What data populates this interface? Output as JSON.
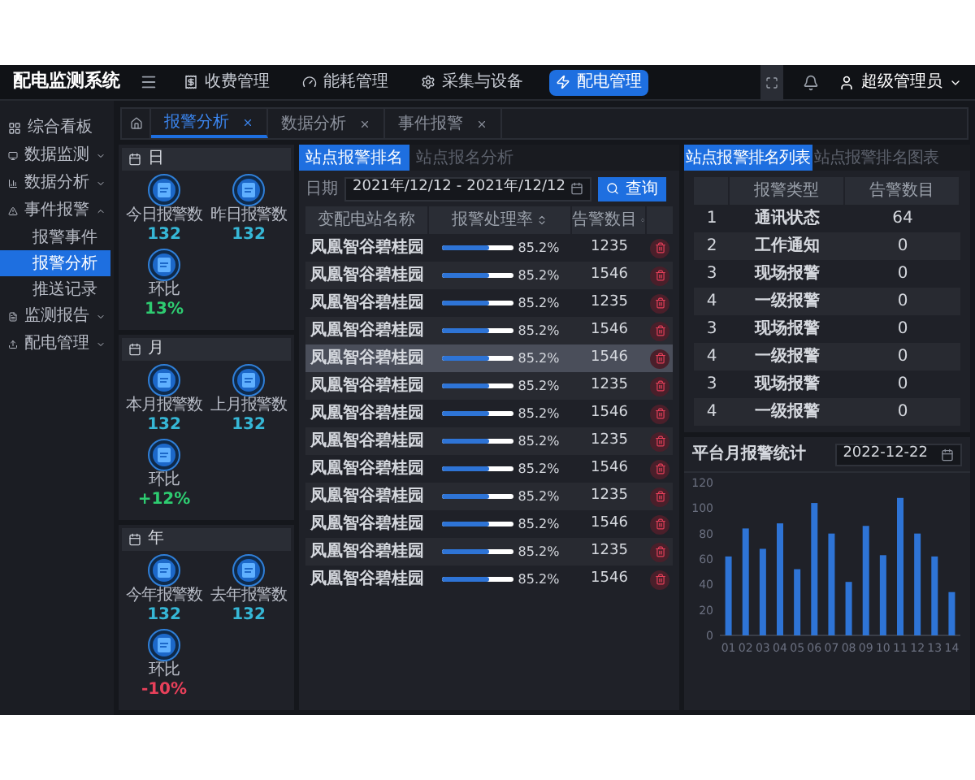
{
  "app_title": "配电监测系统",
  "nav": [
    {
      "label": "收费管理",
      "selected": false
    },
    {
      "label": "能耗管理",
      "selected": false
    },
    {
      "label": "采集与设备",
      "selected": false
    },
    {
      "label": "配电管理",
      "selected": true
    }
  ],
  "user": {
    "name": "超级管理员"
  },
  "sidebar": {
    "items": [
      {
        "label": "综合看板",
        "kind": "link"
      },
      {
        "label": "数据监测",
        "kind": "group",
        "expanded": false
      },
      {
        "label": "数据分析",
        "kind": "group",
        "expanded": false
      },
      {
        "label": "事件报警",
        "kind": "group",
        "expanded": true,
        "children": [
          {
            "label": "报警事件",
            "selected": false
          },
          {
            "label": "报警分析",
            "selected": true
          },
          {
            "label": "推送记录",
            "selected": false
          }
        ]
      },
      {
        "label": "监测报告",
        "kind": "group",
        "expanded": false
      },
      {
        "label": "配电管理",
        "kind": "group",
        "expanded": false
      }
    ]
  },
  "page_tabs": [
    {
      "label": "报警分析",
      "selected": true
    },
    {
      "label": "数据分析",
      "selected": false
    },
    {
      "label": "事件报警",
      "selected": false
    }
  ],
  "summary_cards": [
    {
      "title": "日",
      "stats": [
        {
          "label": "今日报警数",
          "value": "132"
        },
        {
          "label": "昨日报警数",
          "value": "132"
        }
      ],
      "ratio": {
        "label": "环比",
        "value": "13%",
        "color": "#2ecc71"
      }
    },
    {
      "title": "月",
      "stats": [
        {
          "label": "本月报警数",
          "value": "132"
        },
        {
          "label": "上月报警数",
          "value": "132"
        }
      ],
      "ratio": {
        "label": "环比",
        "value": "+12%",
        "color": "#2ecc71"
      }
    },
    {
      "title": "年",
      "stats": [
        {
          "label": "今年报警数",
          "value": "132"
        },
        {
          "label": "去年报警数",
          "value": "132"
        }
      ],
      "ratio": {
        "label": "环比",
        "value": "-10%",
        "color": "#e8405a"
      }
    }
  ],
  "ranking_panel": {
    "tabs": [
      {
        "label": "站点报警排名",
        "selected": true
      },
      {
        "label": "站点报名分析",
        "selected": false
      }
    ],
    "date_label": "日期",
    "date_start": "2021年/12/12",
    "date_separator": "-",
    "date_end": "2021年/12/12",
    "query_button": "查询",
    "columns": [
      "变配电站名称",
      "报警处理率",
      "告警数目"
    ],
    "rows": [
      {
        "name": "凤凰智谷碧桂园",
        "level": 0.66,
        "rate": "85.2%",
        "count": "1235",
        "selected": false
      },
      {
        "name": "凤凰智谷碧桂园",
        "level": 0.66,
        "rate": "85.2%",
        "count": "1546",
        "selected": false
      },
      {
        "name": "凤凰智谷碧桂园",
        "level": 0.66,
        "rate": "85.2%",
        "count": "1235",
        "selected": false
      },
      {
        "name": "凤凰智谷碧桂园",
        "level": 0.66,
        "rate": "85.2%",
        "count": "1546",
        "selected": false
      },
      {
        "name": "凤凰智谷碧桂园",
        "level": 0.66,
        "rate": "85.2%",
        "count": "1546",
        "selected": true
      },
      {
        "name": "凤凰智谷碧桂园",
        "level": 0.66,
        "rate": "85.2%",
        "count": "1235",
        "selected": false
      },
      {
        "name": "凤凰智谷碧桂园",
        "level": 0.66,
        "rate": "85.2%",
        "count": "1546",
        "selected": false
      },
      {
        "name": "凤凰智谷碧桂园",
        "level": 0.66,
        "rate": "85.2%",
        "count": "1235",
        "selected": false
      },
      {
        "name": "凤凰智谷碧桂园",
        "level": 0.66,
        "rate": "85.2%",
        "count": "1546",
        "selected": false
      },
      {
        "name": "凤凰智谷碧桂园",
        "level": 0.66,
        "rate": "85.2%",
        "count": "1235",
        "selected": false
      },
      {
        "name": "凤凰智谷碧桂园",
        "level": 0.66,
        "rate": "85.2%",
        "count": "1546",
        "selected": false
      },
      {
        "name": "凤凰智谷碧桂园",
        "level": 0.66,
        "rate": "85.2%",
        "count": "1235",
        "selected": false
      },
      {
        "name": "凤凰智谷碧桂园",
        "level": 0.66,
        "rate": "85.2%",
        "count": "1546",
        "selected": false
      }
    ]
  },
  "type_panel": {
    "tabs": [
      {
        "label": "站点报警排名列表",
        "selected": true
      },
      {
        "label": "站点报警排名图表",
        "selected": false
      }
    ],
    "columns": [
      "报警类型",
      "告警数目"
    ],
    "rows": [
      {
        "index": "1",
        "type": "通讯状态",
        "count": "64"
      },
      {
        "index": "2",
        "type": "工作通知",
        "count": "0"
      },
      {
        "index": "3",
        "type": "现场报警",
        "count": "0"
      },
      {
        "index": "4",
        "type": "一级报警",
        "count": "0"
      },
      {
        "index": "3",
        "type": "现场报警",
        "count": "0"
      },
      {
        "index": "4",
        "type": "一级报警",
        "count": "0"
      },
      {
        "index": "3",
        "type": "现场报警",
        "count": "0"
      },
      {
        "index": "4",
        "type": "一级报警",
        "count": "0"
      }
    ]
  },
  "monthly_panel": {
    "title": "平台月报警统计",
    "date": "2022-12-22",
    "chart_data": {
      "type": "bar",
      "categories": [
        "01",
        "02",
        "03",
        "04",
        "05",
        "06",
        "07",
        "08",
        "09",
        "10",
        "11",
        "12",
        "13",
        "14"
      ],
      "values": [
        62,
        84,
        68,
        88,
        52,
        104,
        80,
        42,
        86,
        63,
        108,
        80,
        62,
        34
      ],
      "ylim": [
        0,
        120
      ],
      "yticks": [
        0,
        20,
        40,
        60,
        80,
        100,
        120
      ]
    }
  }
}
